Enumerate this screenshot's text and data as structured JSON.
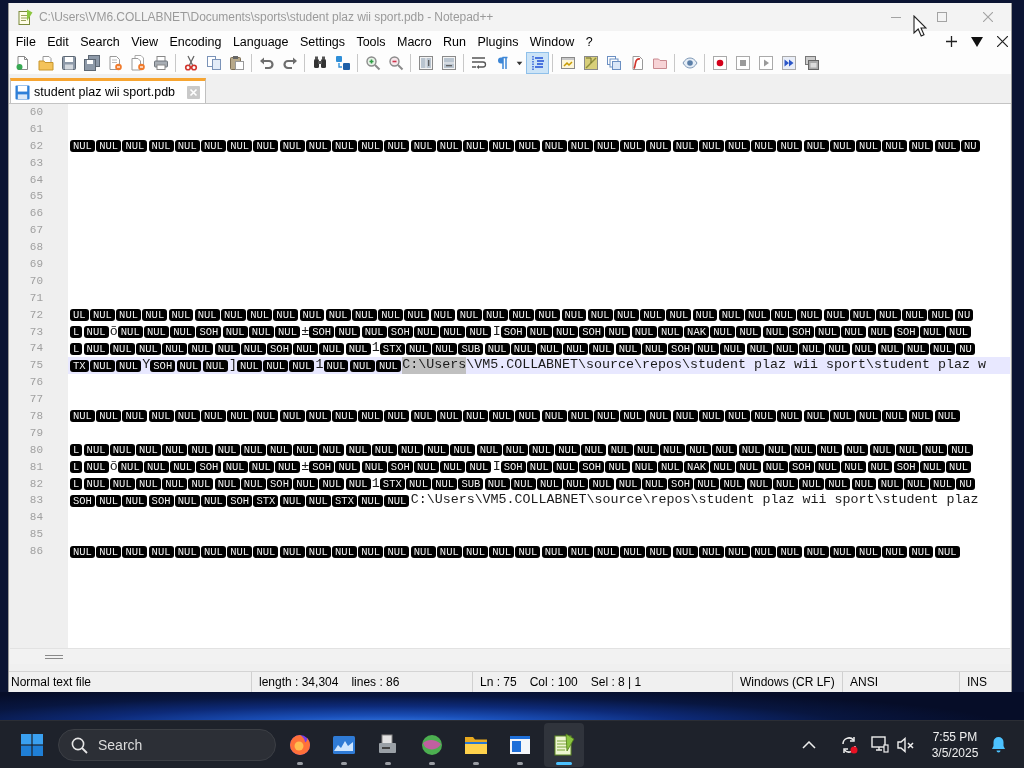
{
  "window": {
    "title": "C:\\Users\\VM6.COLLABNET\\Documents\\sports\\student plaz wii sport.pdb - Notepad++",
    "focused": false
  },
  "menu": [
    "File",
    "Edit",
    "Search",
    "View",
    "Encoding",
    "Language",
    "Settings",
    "Tools",
    "Macro",
    "Run",
    "Plugins",
    "Window",
    "?"
  ],
  "toolbar": {
    "groups": [
      {
        "buttons": [
          {
            "on": false
          },
          {
            "on": false
          },
          {
            "on": false
          },
          {
            "on": false
          },
          {
            "on": false
          },
          {
            "on": false
          },
          {
            "on": false
          }
        ]
      },
      {
        "buttons": [
          {
            "on": false
          },
          {
            "on": false
          },
          {
            "on": false
          }
        ]
      },
      {
        "buttons": [
          {
            "on": false
          },
          {
            "on": false
          }
        ]
      },
      {
        "buttons": [
          {
            "on": false
          },
          {
            "on": false
          }
        ]
      },
      {
        "buttons": [
          {
            "on": false
          },
          {
            "on": false
          }
        ]
      },
      {
        "buttons": [
          {
            "on": false
          },
          {
            "on": false
          }
        ]
      },
      {
        "buttons": [
          {
            "on": false
          },
          {
            "on": false
          },
          {
            "on": false
          },
          {
            "on": true
          }
        ]
      },
      {
        "buttons": [
          {
            "on": false
          },
          {
            "on": false
          },
          {
            "on": false
          },
          {
            "on": false
          },
          {
            "on": false
          }
        ]
      },
      {
        "buttons": [
          {
            "on": false
          }
        ]
      },
      {
        "buttons": [
          {
            "on": false
          },
          {
            "on": false
          },
          {
            "on": false
          },
          {
            "on": false
          },
          {
            "on": false
          }
        ]
      }
    ]
  },
  "tabs": [
    {
      "label": "student plaz wii sport.pdb",
      "selected": true,
      "modified": false
    }
  ],
  "editor": {
    "lines": [
      {
        "number": "60",
        "current": false
      },
      {
        "number": "61",
        "current": false
      },
      {
        "number": "62",
        "current": false,
        "segments": [
          {
            "kind": "ctrl",
            "selected": false,
            "texts": [
              "NUL",
              "NUL",
              "NUL",
              "NUL",
              "NUL",
              "NUL",
              "NUL",
              "NUL",
              "NUL",
              "NUL",
              "NUL",
              "NUL",
              "NUL",
              "NUL",
              "NUL",
              "NUL",
              "NUL",
              "NUL",
              "NUL",
              "NUL",
              "NUL",
              "NUL",
              "NUL",
              "NUL",
              "NUL",
              "NUL",
              "NUL",
              "NUL",
              "NUL",
              "NUL",
              "NUL",
              "NUL",
              "NUL",
              "NUL",
              "NU"
            ]
          }
        ]
      },
      {
        "number": "63",
        "current": false
      },
      {
        "number": "64",
        "current": false
      },
      {
        "number": "65",
        "current": false
      },
      {
        "number": "66",
        "current": false
      },
      {
        "number": "67",
        "current": false
      },
      {
        "number": "68",
        "current": false
      },
      {
        "number": "69",
        "current": false
      },
      {
        "number": "70",
        "current": false
      },
      {
        "number": "71",
        "current": false
      },
      {
        "number": "72",
        "current": false,
        "segments": [
          {
            "kind": "ctrl",
            "selected": false,
            "texts": [
              "UL",
              "NUL",
              "NUL",
              "NUL",
              "NUL",
              "NUL",
              "NUL",
              "NUL",
              "NUL",
              "NUL",
              "NUL",
              "NUL",
              "NUL",
              "NUL",
              "NUL",
              "NUL",
              "NUL",
              "NUL",
              "NUL",
              "NUL",
              "NUL",
              "NUL",
              "NUL",
              "NUL",
              "NUL",
              "NUL",
              "NUL",
              "NUL",
              "NUL",
              "NUL",
              "NUL",
              "NUL",
              "NUL",
              "NUL",
              "NU"
            ]
          }
        ]
      },
      {
        "number": "73",
        "current": false,
        "segments": [
          {
            "kind": "ctrl",
            "selected": false,
            "texts": [
              "L",
              "NUL"
            ]
          },
          {
            "kind": "text",
            "selected": false,
            "text": "õ"
          },
          {
            "kind": "ctrl",
            "selected": false,
            "texts": [
              "NUL",
              "NUL",
              "NUL",
              "SOH",
              "NUL",
              "NUL",
              "NUL"
            ]
          },
          {
            "kind": "text",
            "selected": false,
            "text": "±"
          },
          {
            "kind": "ctrl",
            "selected": false,
            "texts": [
              "SOH",
              "NUL",
              "NUL",
              "SOH",
              "NUL",
              "NUL",
              "NUL"
            ]
          },
          {
            "kind": "text",
            "selected": false,
            "text": "I"
          },
          {
            "kind": "ctrl",
            "selected": false,
            "texts": [
              "SOH",
              "NUL",
              "NUL",
              "SOH",
              "NUL",
              "NUL",
              "NUL",
              "NAK",
              "NUL",
              "NUL",
              "NUL",
              "SOH",
              "NUL",
              "NUL",
              "NUL",
              "SOH",
              "NUL",
              "NUL"
            ]
          }
        ]
      },
      {
        "number": "74",
        "current": false,
        "segments": [
          {
            "kind": "ctrl",
            "selected": false,
            "texts": [
              "L",
              "NUL",
              "NUL",
              "NUL",
              "NUL",
              "NUL",
              "NUL",
              "NUL",
              "SOH",
              "NUL",
              "NUL",
              "NUL"
            ]
          },
          {
            "kind": "text",
            "selected": false,
            "text": "1"
          },
          {
            "kind": "ctrl",
            "selected": false,
            "texts": [
              "STX",
              "NUL",
              "NUL",
              "SUB",
              "NUL",
              "NUL",
              "NUL",
              "NUL",
              "NUL",
              "NUL",
              "NUL",
              "SOH",
              "NUL",
              "NUL",
              "NUL",
              "NUL",
              "NUL",
              "NUL",
              "NUL",
              "NUL",
              "NUL",
              "NUL",
              "NU"
            ]
          }
        ]
      },
      {
        "number": "75",
        "current": true,
        "segments": [
          {
            "kind": "ctrl",
            "selected": false,
            "texts": [
              "TX",
              "NUL",
              "NUL"
            ]
          },
          {
            "kind": "text",
            "selected": false,
            "text": "Y"
          },
          {
            "kind": "ctrl",
            "selected": false,
            "texts": [
              "SOH",
              "NUL",
              "NUL"
            ]
          },
          {
            "kind": "text",
            "selected": false,
            "text": "]"
          },
          {
            "kind": "ctrl",
            "selected": false,
            "texts": [
              "NUL",
              "NUL",
              "NUL"
            ]
          },
          {
            "kind": "text",
            "selected": false,
            "text": "1"
          },
          {
            "kind": "ctrl",
            "selected": false,
            "texts": [
              "NUL",
              "NUL",
              "NUL"
            ]
          },
          {
            "kind": "text",
            "selected": true,
            "text": "C:\\Users"
          },
          {
            "kind": "text",
            "selected": false,
            "text": "\\VM5.COLLABNET\\source\\repos\\student plaz wii sport\\student plaz w"
          }
        ]
      },
      {
        "number": "76",
        "current": false
      },
      {
        "number": "77",
        "current": false
      },
      {
        "number": "78",
        "current": false,
        "segments": [
          {
            "kind": "ctrl",
            "selected": false,
            "texts": [
              "NUL",
              "NUL",
              "NUL",
              "NUL",
              "NUL",
              "NUL",
              "NUL",
              "NUL",
              "NUL",
              "NUL",
              "NUL",
              "NUL",
              "NUL",
              "NUL",
              "NUL",
              "NUL",
              "NUL",
              "NUL",
              "NUL",
              "NUL",
              "NUL",
              "NUL",
              "NUL",
              "NUL",
              "NUL",
              "NUL",
              "NUL",
              "NUL",
              "NUL",
              "NUL",
              "NUL",
              "NUL",
              "NUL",
              "NUL"
            ]
          }
        ]
      },
      {
        "number": "79",
        "current": false
      },
      {
        "number": "80",
        "current": false,
        "segments": [
          {
            "kind": "ctrl",
            "selected": false,
            "texts": [
              "L",
              "NUL",
              "NUL",
              "NUL",
              "NUL",
              "NUL",
              "NUL",
              "NUL",
              "NUL",
              "NUL",
              "NUL",
              "NUL",
              "NUL",
              "NUL",
              "NUL",
              "NUL",
              "NUL",
              "NUL",
              "NUL",
              "NUL",
              "NUL",
              "NUL",
              "NUL",
              "NUL",
              "NUL",
              "NUL",
              "NUL",
              "NUL",
              "NUL",
              "NUL",
              "NUL",
              "NUL",
              "NUL",
              "NUL",
              "NUL"
            ]
          }
        ]
      },
      {
        "number": "81",
        "current": false,
        "segments": [
          {
            "kind": "ctrl",
            "selected": false,
            "texts": [
              "L",
              "NUL"
            ]
          },
          {
            "kind": "text",
            "selected": false,
            "text": "õ"
          },
          {
            "kind": "ctrl",
            "selected": false,
            "texts": [
              "NUL",
              "NUL",
              "NUL",
              "SOH",
              "NUL",
              "NUL",
              "NUL"
            ]
          },
          {
            "kind": "text",
            "selected": false,
            "text": "±"
          },
          {
            "kind": "ctrl",
            "selected": false,
            "texts": [
              "SOH",
              "NUL",
              "NUL",
              "SOH",
              "NUL",
              "NUL",
              "NUL"
            ]
          },
          {
            "kind": "text",
            "selected": false,
            "text": "I"
          },
          {
            "kind": "ctrl",
            "selected": false,
            "texts": [
              "SOH",
              "NUL",
              "NUL",
              "SOH",
              "NUL",
              "NUL",
              "NUL",
              "NAK",
              "NUL",
              "NUL",
              "NUL",
              "SOH",
              "NUL",
              "NUL",
              "NUL",
              "SOH",
              "NUL",
              "NUL"
            ]
          }
        ]
      },
      {
        "number": "82",
        "current": false,
        "segments": [
          {
            "kind": "ctrl",
            "selected": false,
            "texts": [
              "L",
              "NUL",
              "NUL",
              "NUL",
              "NUL",
              "NUL",
              "NUL",
              "NUL",
              "SOH",
              "NUL",
              "NUL",
              "NUL"
            ]
          },
          {
            "kind": "text",
            "selected": false,
            "text": "1"
          },
          {
            "kind": "ctrl",
            "selected": false,
            "texts": [
              "STX",
              "NUL",
              "NUL",
              "SUB",
              "NUL",
              "NUL",
              "NUL",
              "NUL",
              "NUL",
              "NUL",
              "NUL",
              "SOH",
              "NUL",
              "NUL",
              "NUL",
              "NUL",
              "NUL",
              "NUL",
              "NUL",
              "NUL",
              "NUL",
              "NUL",
              "NU"
            ]
          }
        ]
      },
      {
        "number": "83",
        "current": false,
        "segments": [
          {
            "kind": "ctrl",
            "selected": false,
            "texts": [
              "SOH",
              "NUL",
              "NUL",
              "SOH",
              "NUL",
              "NUL",
              "SOH",
              "STX",
              "NUL",
              "NUL",
              "STX",
              "NUL",
              "NUL"
            ]
          },
          {
            "kind": "text",
            "selected": false,
            "text": "C:\\Users\\VM5.COLLABNET\\source\\repos\\student plaz wii sport\\student plaz"
          }
        ]
      },
      {
        "number": "84",
        "current": false
      },
      {
        "number": "85",
        "current": false
      },
      {
        "number": "86",
        "current": false,
        "segments": [
          {
            "kind": "ctrl",
            "selected": false,
            "texts": [
              "NUL",
              "NUL",
              "NUL",
              "NUL",
              "NUL",
              "NUL",
              "NUL",
              "NUL",
              "NUL",
              "NUL",
              "NUL",
              "NUL",
              "NUL",
              "NUL",
              "NUL",
              "NUL",
              "NUL",
              "NUL",
              "NUL",
              "NUL",
              "NUL",
              "NUL",
              "NUL",
              "NUL",
              "NUL",
              "NUL",
              "NUL",
              "NUL",
              "NUL",
              "NUL",
              "NUL",
              "NUL",
              "NUL",
              "NUL"
            ]
          }
        ]
      }
    ]
  },
  "status_bar": {
    "sections": [
      {
        "texts": [
          "Normal text file"
        ]
      },
      {
        "texts": [
          "length : 34,304",
          "lines : 86"
        ]
      },
      {
        "texts": [
          "Ln : 75",
          "Col : 100",
          "Sel : 8 | 1"
        ]
      },
      {
        "texts": [
          "Windows (CR LF)"
        ]
      },
      {
        "texts": [
          "ANSI"
        ]
      },
      {
        "texts": [
          "INS"
        ]
      }
    ]
  },
  "taskbar": {
    "search": {
      "placeholder": "Search"
    },
    "apps": [
      {
        "running": true,
        "selected": false
      },
      {
        "running": true,
        "selected": false
      },
      {
        "running": true,
        "selected": false
      },
      {
        "running": true,
        "selected": false
      },
      {
        "running": true,
        "selected": false
      },
      {
        "running": true,
        "selected": false
      },
      {
        "running": true,
        "selected": true
      }
    ],
    "clock": {
      "time": "7:55 PM",
      "date": "3/5/2025"
    }
  }
}
